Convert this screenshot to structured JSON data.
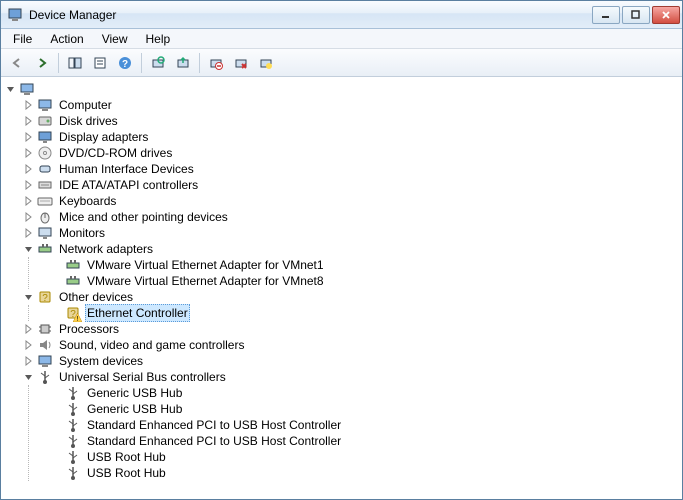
{
  "window": {
    "title": "Device Manager"
  },
  "menu": {
    "file": "File",
    "action": "Action",
    "view": "View",
    "help": "Help"
  },
  "toolbar_icons": {
    "back": "back-arrow-icon",
    "forward": "forward-arrow-icon",
    "up": "up-level-icon",
    "properties": "properties-icon",
    "help": "help-icon",
    "refresh": "refresh-icon",
    "scan": "scan-hardware-icon",
    "update": "update-driver-icon",
    "uninstall": "uninstall-icon",
    "disable": "disable-icon"
  },
  "tree": {
    "root": {
      "label": "",
      "expanded": true
    },
    "nodes": [
      {
        "key": "computer",
        "label": "Computer",
        "icon": "computer-icon",
        "expanded": false
      },
      {
        "key": "diskdrives",
        "label": "Disk drives",
        "icon": "disk-icon",
        "expanded": false
      },
      {
        "key": "display",
        "label": "Display adapters",
        "icon": "display-icon",
        "expanded": false
      },
      {
        "key": "dvd",
        "label": "DVD/CD-ROM drives",
        "icon": "dvd-icon",
        "expanded": false
      },
      {
        "key": "hid",
        "label": "Human Interface Devices",
        "icon": "hid-icon",
        "expanded": false
      },
      {
        "key": "ide",
        "label": "IDE ATA/ATAPI controllers",
        "icon": "ide-icon",
        "expanded": false
      },
      {
        "key": "keyboards",
        "label": "Keyboards",
        "icon": "keyboard-icon",
        "expanded": false
      },
      {
        "key": "mice",
        "label": "Mice and other pointing devices",
        "icon": "mouse-icon",
        "expanded": false
      },
      {
        "key": "monitors",
        "label": "Monitors",
        "icon": "monitor-icon",
        "expanded": false
      },
      {
        "key": "network",
        "label": "Network adapters",
        "icon": "network-icon",
        "expanded": true,
        "children": [
          {
            "key": "vmnet1",
            "label": "VMware Virtual Ethernet Adapter for VMnet1",
            "icon": "nic-icon"
          },
          {
            "key": "vmnet8",
            "label": "VMware Virtual Ethernet Adapter for VMnet8",
            "icon": "nic-icon"
          }
        ]
      },
      {
        "key": "other",
        "label": "Other devices",
        "icon": "other-icon",
        "expanded": true,
        "children": [
          {
            "key": "ethctrl",
            "label": "Ethernet Controller",
            "icon": "unknown-device-icon",
            "warning": true,
            "selected": true
          }
        ]
      },
      {
        "key": "processors",
        "label": "Processors",
        "icon": "cpu-icon",
        "expanded": false
      },
      {
        "key": "sound",
        "label": "Sound, video and game controllers",
        "icon": "sound-icon",
        "expanded": false
      },
      {
        "key": "system",
        "label": "System devices",
        "icon": "system-icon",
        "expanded": false
      },
      {
        "key": "usb",
        "label": "Universal Serial Bus controllers",
        "icon": "usb-icon",
        "expanded": true,
        "children": [
          {
            "key": "usb0",
            "label": "Generic USB Hub",
            "icon": "usb-plug-icon"
          },
          {
            "key": "usb1",
            "label": "Generic USB Hub",
            "icon": "usb-plug-icon"
          },
          {
            "key": "usb2",
            "label": "Standard Enhanced PCI to USB Host Controller",
            "icon": "usb-plug-icon"
          },
          {
            "key": "usb3",
            "label": "Standard Enhanced PCI to USB Host Controller",
            "icon": "usb-plug-icon"
          },
          {
            "key": "usb4",
            "label": "USB Root Hub",
            "icon": "usb-plug-icon"
          },
          {
            "key": "usb5",
            "label": "USB Root Hub",
            "icon": "usb-plug-icon"
          }
        ]
      }
    ]
  }
}
